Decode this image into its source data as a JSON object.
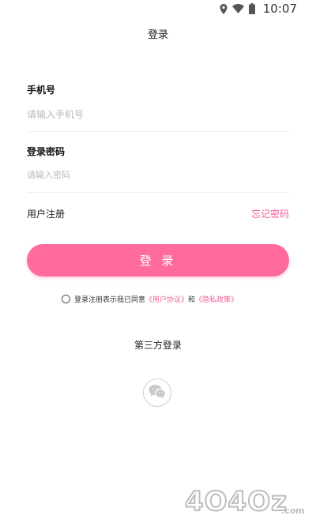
{
  "status_bar": {
    "time": "10:07",
    "icons": [
      "location-icon",
      "wifi-icon",
      "battery-icon"
    ]
  },
  "page": {
    "title": "登录"
  },
  "form": {
    "phone_label": "手机号",
    "phone_placeholder": "请输入手机号",
    "password_label": "登录密码",
    "password_placeholder": "请输入密码"
  },
  "links": {
    "register": "用户注册",
    "forgot_password": "忘记密码"
  },
  "login_button": {
    "label": "登 录"
  },
  "agreement": {
    "prefix": "登录注册表示我已同意",
    "user_agreement": "《用户协议》",
    "connector": "和",
    "privacy_policy": "《隐私政策》",
    "checked": false
  },
  "third_party": {
    "title": "第三方登录",
    "provider_icon": "wechat-icon"
  },
  "watermark": {
    "text": "4O4Oz.com"
  },
  "colors": {
    "accent": "#ff6b9c",
    "link": "#f0609a",
    "placeholder": "#b9b9b9"
  }
}
